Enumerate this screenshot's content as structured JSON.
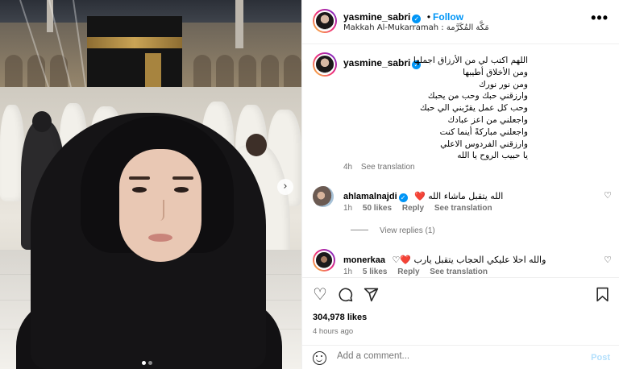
{
  "post": {
    "author": "yasmine_sabri",
    "follow_label": "Follow",
    "location": "Makkah Al-Mukarramah : مَكَّة المُكَرَّمة",
    "more_icon": "more-horizontal-icon",
    "verified_icon": "verified-badge-icon",
    "caption_lines": [
      "اللهم اكتب لي من الأرزاق اجملها",
      "ومن الأخلاق أطيبها",
      "ومن نور نورك",
      "وارزقني حبك وحب من يحبك",
      "وحب كل عمل يقرّبني الي حبك",
      "واجعلني من اعز عبادك",
      "واجعلني مباركةً أينما كنت",
      "وارزقني الفردوس الاعلي",
      "يا حبيب الروح يا الله"
    ],
    "caption_time": "4h",
    "see_translation": "See translation"
  },
  "comments": [
    {
      "user": "ahlamalnajdi",
      "verified": true,
      "text": "الله يتقبل ماشاء الله ❤️",
      "time": "1h",
      "likes": "50 likes",
      "reply": "Reply",
      "translate": "See translation",
      "view_replies": "View replies (1)"
    },
    {
      "user": "monerkaa",
      "verified": false,
      "text": "والله احلا عليكي الحجاب يتقبل يارب ❤️♡",
      "time": "1h",
      "likes": "5 likes",
      "reply": "Reply",
      "translate": "See translation"
    }
  ],
  "actions": {
    "like_icon": "heart-icon",
    "comment_icon": "comment-icon",
    "share_icon": "share-icon",
    "save_icon": "bookmark-icon",
    "likes_count": "304,978 likes",
    "time_ago": "4 hours ago"
  },
  "add_comment": {
    "placeholder": "Add a comment...",
    "post_label": "Post"
  },
  "carousel": {
    "current_slide": 1,
    "total_slides": 2
  },
  "colors": {
    "accent": "#0095f6",
    "post_disabled": "#b2dffc",
    "like_red": "#ed4956"
  }
}
